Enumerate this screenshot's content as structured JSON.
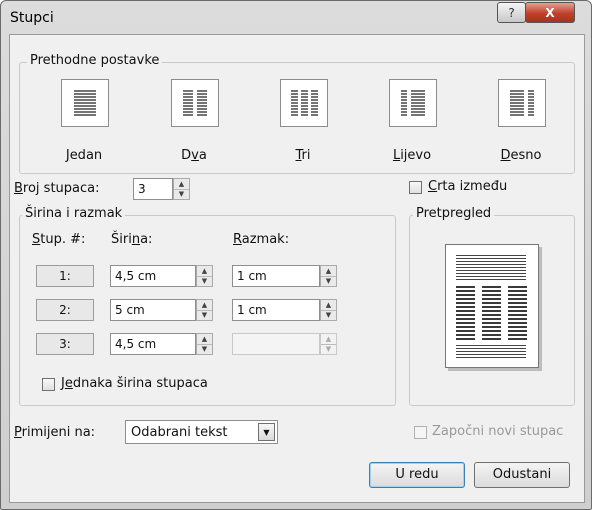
{
  "window": {
    "title": "Stupci",
    "help_symbol": "?",
    "close_symbol": "X"
  },
  "presets": {
    "label": "Prethodne postavke",
    "items": [
      {
        "key": "J",
        "rest": "edan",
        "icon": "one-column-icon"
      },
      {
        "key": "D",
        "pre": "",
        "rest": "va",
        "icon": "two-columns-icon",
        "label": "Dva"
      },
      {
        "key": "T",
        "rest": "ri",
        "icon": "three-columns-icon"
      },
      {
        "key": "L",
        "rest": "ijevo",
        "icon": "left-columns-icon"
      },
      {
        "key": "D",
        "rest": "esno",
        "icon": "right-columns-icon"
      }
    ]
  },
  "num_columns": {
    "label_key": "B",
    "label_rest": "roj stupaca:",
    "value": "3"
  },
  "line_between": {
    "label_key": "C",
    "label_rest": "rta između",
    "checked": false
  },
  "width_spacing": {
    "label": "Širina i razmak",
    "col_header_key": "S",
    "col_header_rest": "tup. #:",
    "width_header_pre": "Širi",
    "width_header_key": "n",
    "width_header_rest": "a:",
    "spacing_header_key": "R",
    "spacing_header_rest": "azmak:",
    "rows": [
      {
        "num": "1:",
        "width": "4,5 cm",
        "spacing": "1 cm"
      },
      {
        "num": "2:",
        "width": "5 cm",
        "spacing": "1 cm"
      },
      {
        "num": "3:",
        "width": "4,5 cm",
        "spacing": ""
      }
    ],
    "equal_width_key": "e",
    "equal_width_pre": "J",
    "equal_width_rest": "dnaka širina stupaca"
  },
  "preview": {
    "label": "Pretpregled"
  },
  "apply_to": {
    "label_key": "P",
    "label_rest": "rimijeni na:",
    "value": "Odabrani tekst"
  },
  "start_new_column": {
    "label": "Započni novi stupac",
    "enabled": false
  },
  "buttons": {
    "ok": "U redu",
    "cancel": "Odustani"
  }
}
